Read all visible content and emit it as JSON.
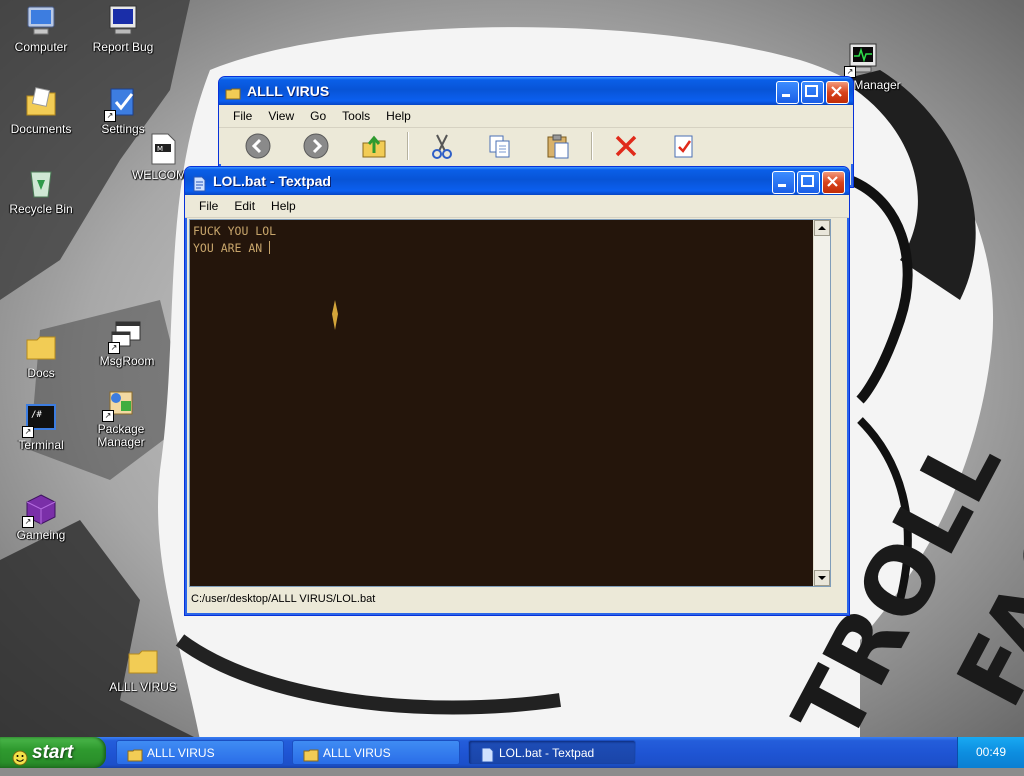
{
  "desktop": {
    "icons": [
      {
        "label": "Computer"
      },
      {
        "label": "Report Bug"
      },
      {
        "label": "Documents"
      },
      {
        "label": "Settings"
      },
      {
        "label": "WELCOME"
      },
      {
        "label": "Recycle Bin"
      },
      {
        "label": "Task Manager"
      },
      {
        "label": "Docs"
      },
      {
        "label": "MsgRoom"
      },
      {
        "label": "Terminal"
      },
      {
        "label": "Package Manager"
      },
      {
        "label": "Gameing"
      },
      {
        "label": "ALLL VIRUS"
      }
    ],
    "wallpaper_text": "TROLL FACE"
  },
  "explorer_window": {
    "title": "ALLL VIRUS",
    "menu": [
      "File",
      "View",
      "Go",
      "Tools",
      "Help"
    ],
    "toolbar": [
      "back-icon",
      "forward-icon",
      "up-folder-icon",
      "cut-icon",
      "copy-icon",
      "paste-icon",
      "delete-icon",
      "properties-icon"
    ]
  },
  "textpad_window": {
    "title": "LOL.bat - Textpad",
    "menu": [
      "File",
      "Edit",
      "Help"
    ],
    "content_lines": [
      "FUCK YOU LOL",
      "YOU ARE AN "
    ],
    "status_path": "C:/user/desktop/ALLL VIRUS/LOL.bat"
  },
  "taskbar": {
    "start_label": "start",
    "tasks": [
      {
        "label": "ALLL VIRUS",
        "active": false
      },
      {
        "label": "ALLL VIRUS",
        "active": false
      },
      {
        "label": "LOL.bat - Textpad",
        "active": true
      }
    ],
    "clock": "00:49"
  },
  "colors": {
    "title_blue": "#0854d6",
    "editor_bg": "#24150b",
    "editor_text": "#c7a56b",
    "start_green": "#2f9a2f"
  }
}
